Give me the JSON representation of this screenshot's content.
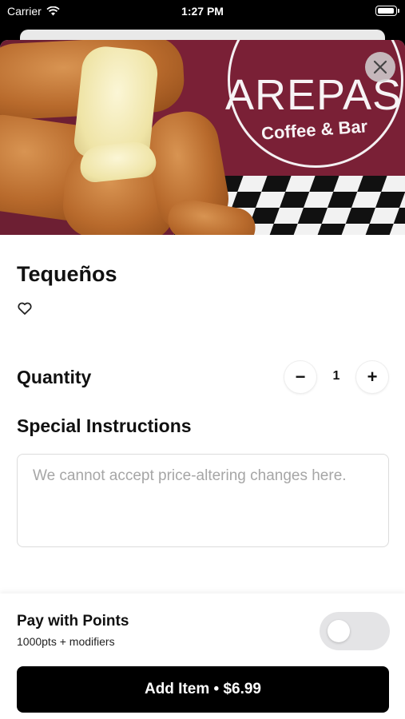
{
  "status_bar": {
    "carrier": "Carrier",
    "time": "1:27 PM"
  },
  "hero": {
    "brand": "AREPAS",
    "sub": "Coffee & Bar",
    "close_icon": "close-icon"
  },
  "item": {
    "title": "Tequeños",
    "favorite_icon": "heart-outline-icon"
  },
  "quantity": {
    "label": "Quantity",
    "value": "1",
    "minus": "−",
    "plus": "+"
  },
  "instructions": {
    "label": "Special Instructions",
    "placeholder": "We cannot accept price-altering changes here."
  },
  "points": {
    "title": "Pay with Points",
    "subtitle": "1000pts + modifiers",
    "enabled": false
  },
  "cta": {
    "label": "Add Item • $6.99"
  },
  "colors": {
    "primary_button": "#000000",
    "toggle_off": "#e4e4e6",
    "hero_banner": "#7a2036"
  }
}
